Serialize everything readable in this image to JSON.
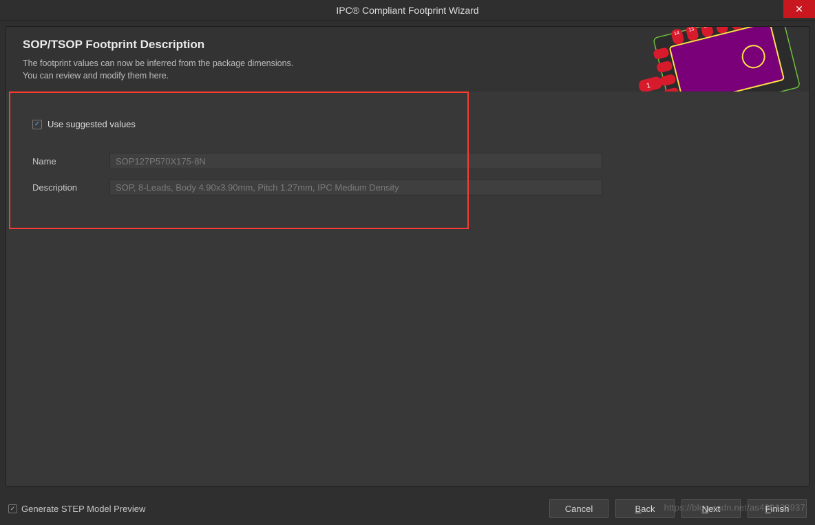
{
  "titlebar": {
    "title": "IPC® Compliant Footprint Wizard"
  },
  "header": {
    "title": "SOP/TSOP Footprint Description",
    "subtitle_line1": "The footprint values can now be inferred from the package dimensions.",
    "subtitle_line2": "You can review and modify them here."
  },
  "form": {
    "use_suggested_label": "Use suggested values",
    "use_suggested_checked": true,
    "name_label": "Name",
    "name_value": "SOP127P570X175-8N",
    "description_label": "Description",
    "description_value": "SOP, 8-Leads, Body 4.90x3.90mm, Pitch 1.27mm, IPC Medium Density"
  },
  "footer": {
    "step_preview_label": "Generate STEP Model Preview",
    "step_preview_checked": true,
    "cancel": "Cancel",
    "back": "Back",
    "next": "Next",
    "finish": "Finish"
  },
  "watermark": "https://blog.csdn.net/as480133937"
}
